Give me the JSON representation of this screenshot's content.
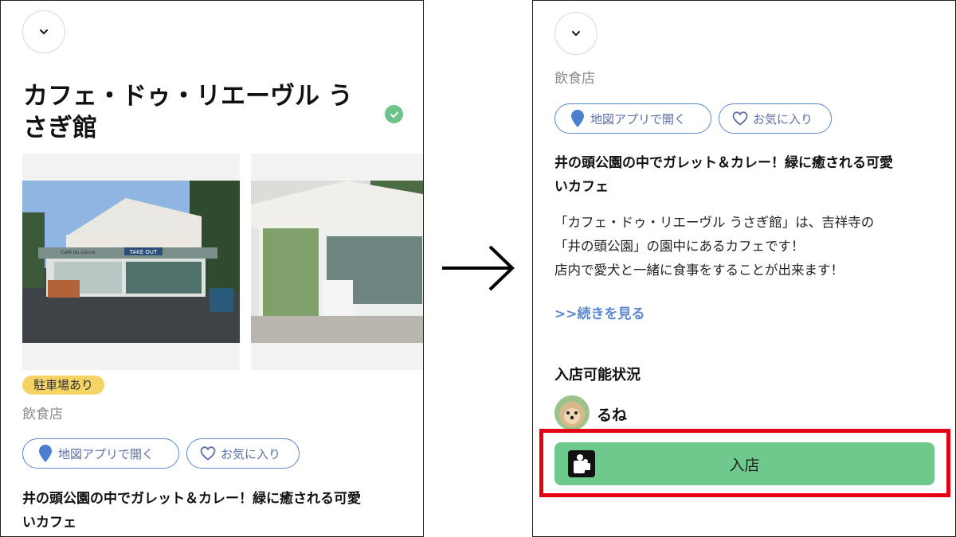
{
  "left": {
    "title": "カフェ・ドゥ・リエーヴル うさぎ館",
    "parking_badge": "駐車場あり",
    "category": "飲食店",
    "map_button": "地図アプリで開く",
    "favorite_button": "お気に入り",
    "headline_line1": "井の頭公園の中でガレット＆カレー！緑に癒される可愛",
    "headline_line2": "いカフェ",
    "photo_signs": [
      "Café du Lièvre",
      "TAKE OUT"
    ]
  },
  "right": {
    "category": "飲食店",
    "map_button": "地図アプリで開く",
    "favorite_button": "お気に入り",
    "headline_line1": "井の頭公園の中でガレット＆カレー！緑に癒される可愛",
    "headline_line2": "いカフェ",
    "description": [
      "「カフェ・ドゥ・リエーヴル うさぎ館」は、吉祥寺の",
      "「井の頭公園」の園中にあるカフェです！",
      "店内で愛犬と一緒に食事をすることが出来ます！"
    ],
    "more_link": ">>続きを見る",
    "availability_title": "入店可能状況",
    "user_name": "るね",
    "enter_button": "入店"
  },
  "icons": [
    "chevron-down-icon",
    "verified-check-icon",
    "map-pin-icon",
    "heart-icon",
    "dog-bag-icon",
    "arrow-right-icon"
  ],
  "colors": {
    "accent_blue": "#5b88cf",
    "enter_green": "#6ec98c",
    "verified_green": "#6cc48a",
    "badge_yellow": "#f6d365",
    "highlight_red": "#e60012"
  }
}
